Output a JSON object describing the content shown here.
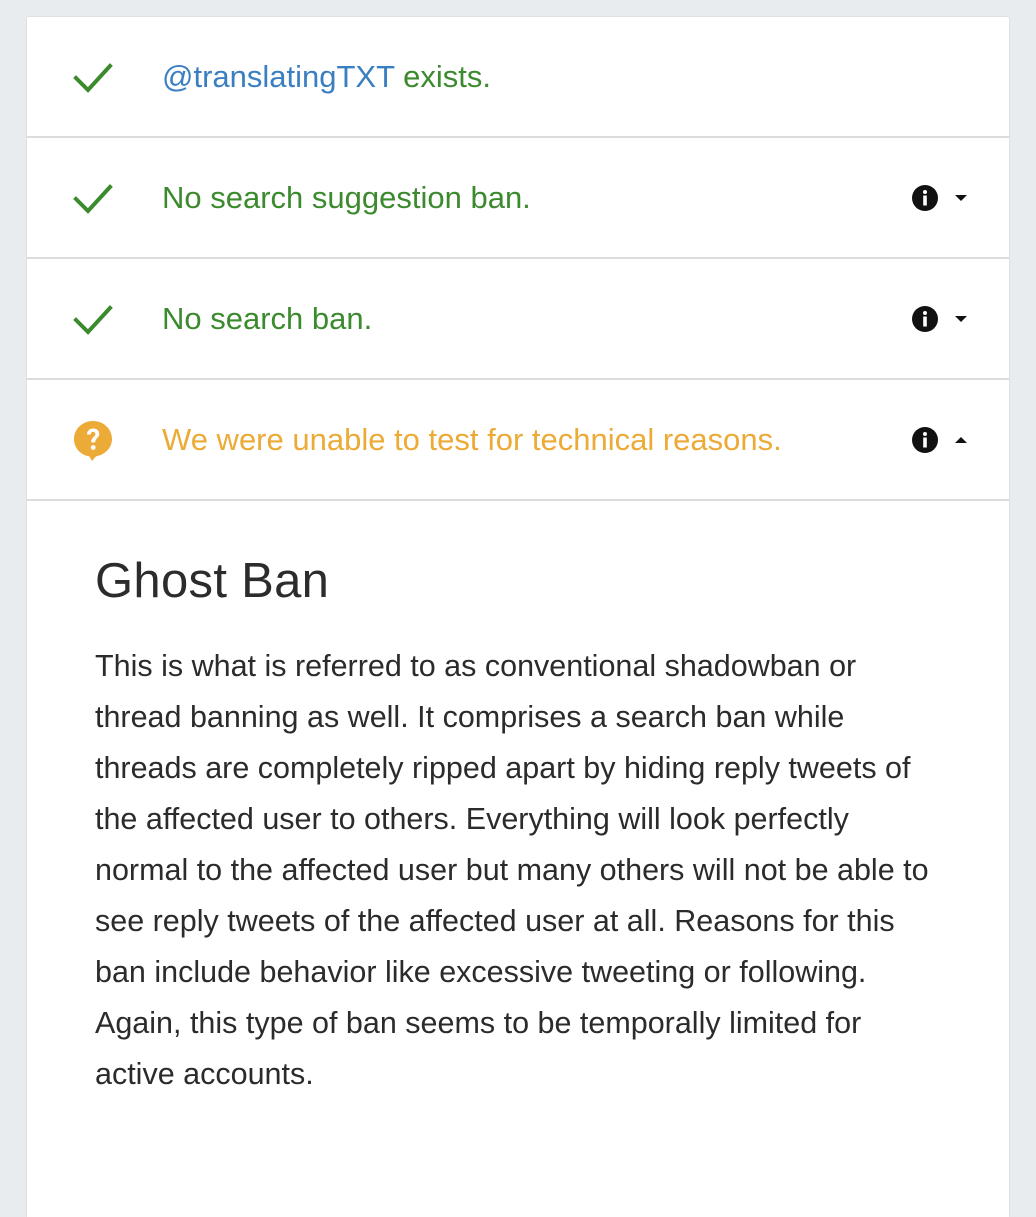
{
  "rows": [
    {
      "status": "ok",
      "handle": "@translatingTXT",
      "text": " exists.",
      "icon": "check-icon",
      "color": "#3c8a2e"
    },
    {
      "status": "ok",
      "text": "No search suggestion ban.",
      "icon": "check-icon",
      "color": "#3c8a2e",
      "expanded": false
    },
    {
      "status": "ok",
      "text": "No search ban.",
      "icon": "check-icon",
      "color": "#3c8a2e",
      "expanded": false
    },
    {
      "status": "unknown",
      "text": "We were unable to test for technical reasons.",
      "icon": "question-bubble-icon",
      "color": "#ecaa36",
      "expanded": true
    }
  ],
  "details": {
    "title": "Ghost Ban",
    "body": "This is what is referred to as conventional shadowban or thread banning as well. It comprises a search ban while threads are completely ripped apart by hiding reply tweets of the affected user to others. Everything will look perfectly normal to the affected user but many others will not be able to see reply tweets of the affected user at all. Reasons for this ban include behavior like excessive tweeting or following. Again, this type of ban seems to be temporally limited for active accounts."
  }
}
